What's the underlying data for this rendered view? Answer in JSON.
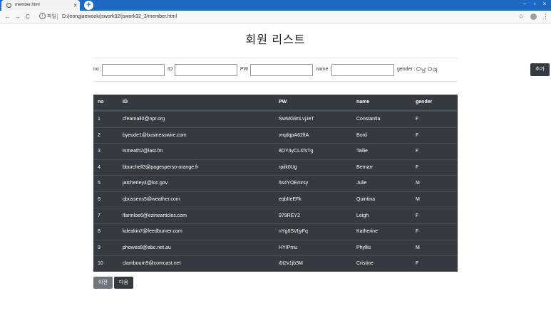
{
  "browser": {
    "tab_title": "member.html",
    "tab_close": "×",
    "new_tab": "+",
    "address_scheme": "파일",
    "address_url": "D:/jeongjaewook/jswork32/jswork32_3/member.html",
    "back": "←",
    "forward": "→",
    "reload": "C",
    "info": "i",
    "bookmark": "☆",
    "menu": "⋮",
    "minimize": "–",
    "maximize": "▫",
    "close": "×"
  },
  "page": {
    "title": "회원 리스트"
  },
  "form": {
    "no_label": "no :",
    "id_label": "ID :",
    "pw_label": "PW :",
    "name_label": "name :",
    "gender_label": "gender :",
    "gender_male": "남",
    "gender_female": "여",
    "add_button": "추가"
  },
  "table": {
    "headers": [
      "no",
      "ID",
      "PW",
      "name",
      "gender"
    ],
    "rows": [
      {
        "no": "1",
        "id": "cfearnall0@npr.org",
        "pw": "NwMG9nLvjJeT",
        "name": "Constantia",
        "gender": "F"
      },
      {
        "no": "2",
        "id": "byeude1@businesswire.com",
        "pw": "vrqdqpA62ftA",
        "name": "Bord",
        "gender": "F"
      },
      {
        "no": "3",
        "id": "tsmeath2@last.fm",
        "pw": "8DY4yCLXfsTg",
        "name": "Tallie",
        "gender": "F"
      },
      {
        "no": "4",
        "id": "bburchell3@pagesperso-orange.fr",
        "pw": "rpiik0Ug",
        "name": "Bernarr",
        "gender": "F"
      },
      {
        "no": "5",
        "id": "jatcherley4@loc.gov",
        "pw": "5s4YOEmrsy",
        "name": "Julie",
        "gender": "M"
      },
      {
        "no": "6",
        "id": "qbussens5@weather.com",
        "pw": "eqbIIeEFk",
        "name": "Quintina",
        "gender": "M"
      },
      {
        "no": "7",
        "id": "lfarmloe6@ezinearticles.com",
        "pw": "979REY2",
        "name": "Leigh",
        "gender": "F"
      },
      {
        "no": "8",
        "id": "kdeakin7@feedburner.com",
        "pw": "nYg6SVIjyFq",
        "name": "Katherine",
        "gender": "F"
      },
      {
        "no": "9",
        "id": "phowes8@abc.net.au",
        "pw": "HYIPmu",
        "name": "Phyllis",
        "gender": "M"
      },
      {
        "no": "10",
        "id": "clambourn9@comcast.net",
        "pw": "i0t2v1jb3M",
        "name": "Cristine",
        "gender": "F"
      }
    ]
  },
  "pager": {
    "prev_label": "이전",
    "next_label": "다음"
  },
  "colors": {
    "titlebar": "#1f69c4",
    "table_bg": "#343a40",
    "button_dark": "#343a40",
    "button_secondary": "#6c757d"
  }
}
